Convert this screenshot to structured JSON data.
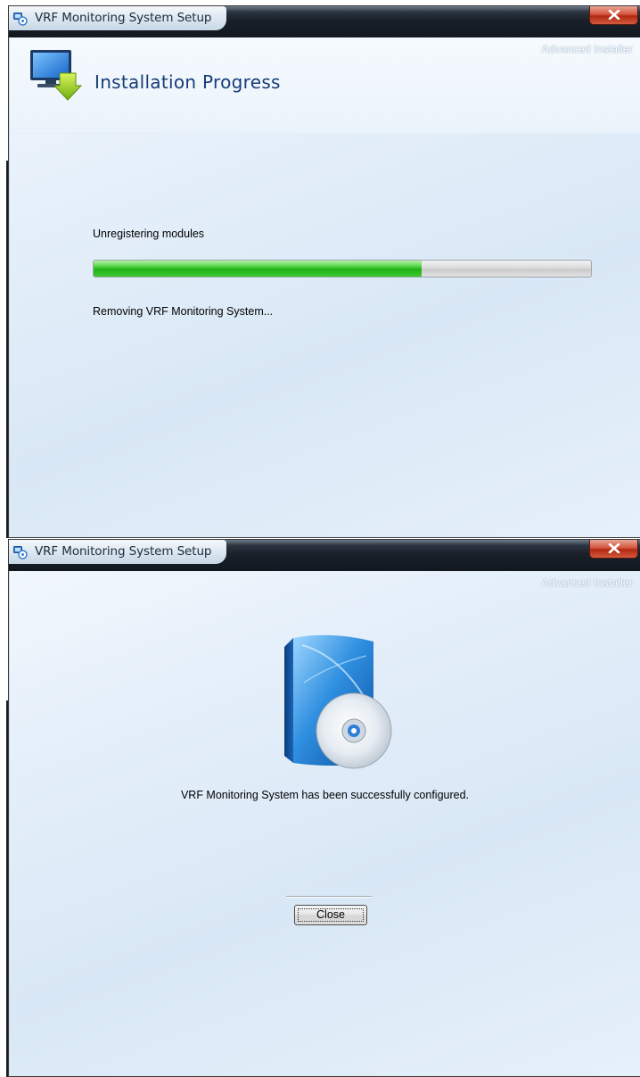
{
  "window1": {
    "title": "VRF Monitoring System Setup",
    "watermark": "Advanced Installer",
    "header_title": "Installation Progress",
    "action_text": "Unregistering modules",
    "progress_percent": 66,
    "status_text": "Removing VRF Monitoring System..."
  },
  "window2": {
    "title": "VRF Monitoring System Setup",
    "watermark": "Advanced Installer",
    "message": "VRF Monitoring System has been successfully configured.",
    "close_button_label": "Close"
  },
  "colors": {
    "header_title": "#163c78",
    "progress_fill": "#1fb317",
    "close_button_red": "#c33a22"
  },
  "icons": {
    "app": "setup-app-icon",
    "header": "monitor-download-icon",
    "product": "software-box-cd-icon",
    "close": "close-x-icon"
  }
}
